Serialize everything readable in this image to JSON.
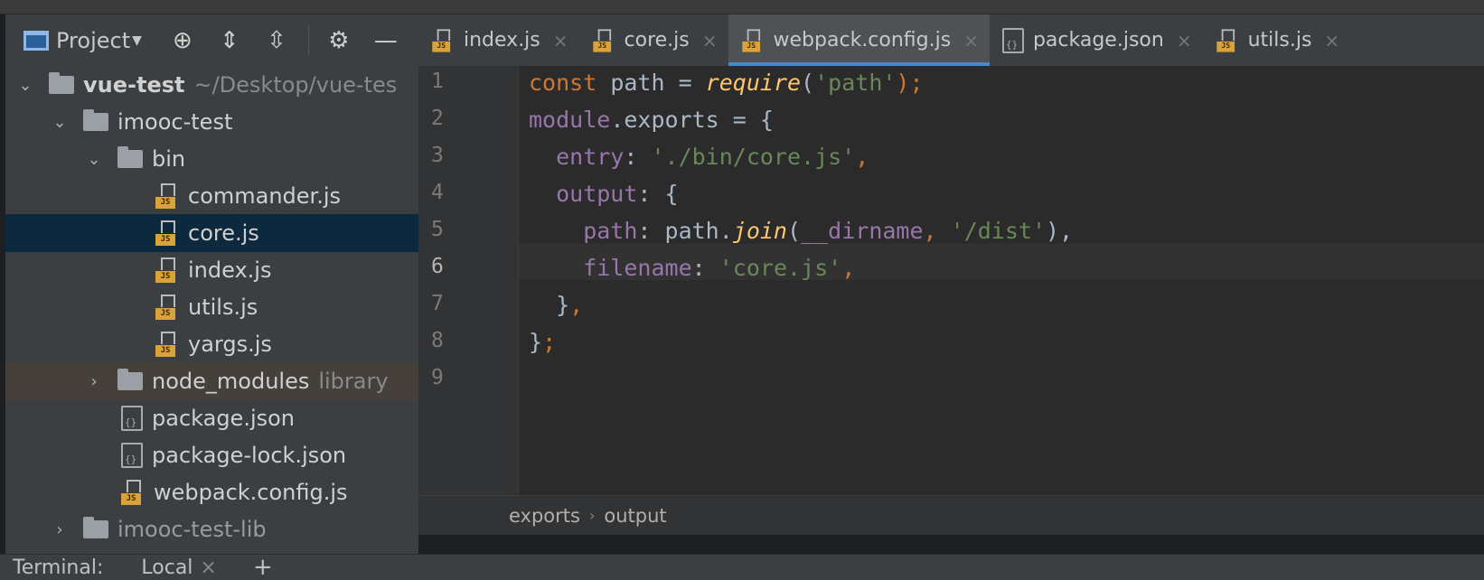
{
  "project_panel": {
    "title": "Project",
    "tree": [
      {
        "label": "vue-test",
        "suffix": "~/Desktop/vue-tes",
        "type": "folder",
        "expanded": true
      },
      {
        "label": "imooc-test",
        "type": "folder",
        "expanded": true
      },
      {
        "label": "bin",
        "type": "folder",
        "expanded": true
      },
      {
        "label": "commander.js",
        "type": "js"
      },
      {
        "label": "core.js",
        "type": "js",
        "selected": true
      },
      {
        "label": "index.js",
        "type": "js"
      },
      {
        "label": "utils.js",
        "type": "js"
      },
      {
        "label": "yargs.js",
        "type": "js"
      },
      {
        "label": "node_modules",
        "suffix": "library",
        "type": "folder",
        "expanded": false
      },
      {
        "label": "package.json",
        "type": "json"
      },
      {
        "label": "package-lock.json",
        "type": "json"
      },
      {
        "label": "webpack.config.js",
        "type": "js"
      },
      {
        "label": "imooc-test-lib",
        "type": "folder",
        "expanded": false
      }
    ]
  },
  "tabs": [
    {
      "label": "index.js",
      "icon": "js-file-icon"
    },
    {
      "label": "core.js",
      "icon": "js-file-icon"
    },
    {
      "label": "webpack.config.js",
      "icon": "js-file-icon",
      "active": true
    },
    {
      "label": "package.json",
      "icon": "json-file-icon"
    },
    {
      "label": "utils.js",
      "icon": "js-file-icon"
    }
  ],
  "editor": {
    "line_numbers": [
      "1",
      "2",
      "3",
      "4",
      "5",
      "6",
      "7",
      "8",
      "9"
    ],
    "current_line": "6",
    "code": {
      "l1": {
        "kw": "const",
        "id": " path = ",
        "fn": "require",
        "p1": "(",
        "str": "'path'",
        "p2": ");"
      },
      "l2": {
        "mod": "module",
        "rest": ".exports = {"
      },
      "l3": {
        "prop": "  entry",
        "colon": ": ",
        "str": "'./bin/core.js'",
        "comma": ","
      },
      "l4": {
        "prop": "  output",
        "rest": ": {"
      },
      "l5": {
        "prop": "    path",
        "colon": ": path.",
        "fn": "join",
        "p1": "(",
        "dn": "__dirname",
        "comma": ", ",
        "str": "'/dist'",
        "p2": "),"
      },
      "l6": {
        "prop": "    filename",
        "colon": ": ",
        "str": "'core.js'",
        "comma": ","
      },
      "l7": {
        "text": "  }",
        "comma": ","
      },
      "l8": {
        "text": "}",
        "semi": ";"
      }
    },
    "breadcrumb": [
      "exports",
      "output"
    ]
  },
  "terminal": {
    "title": "Terminal:",
    "tab": "Local",
    "add": "+"
  }
}
